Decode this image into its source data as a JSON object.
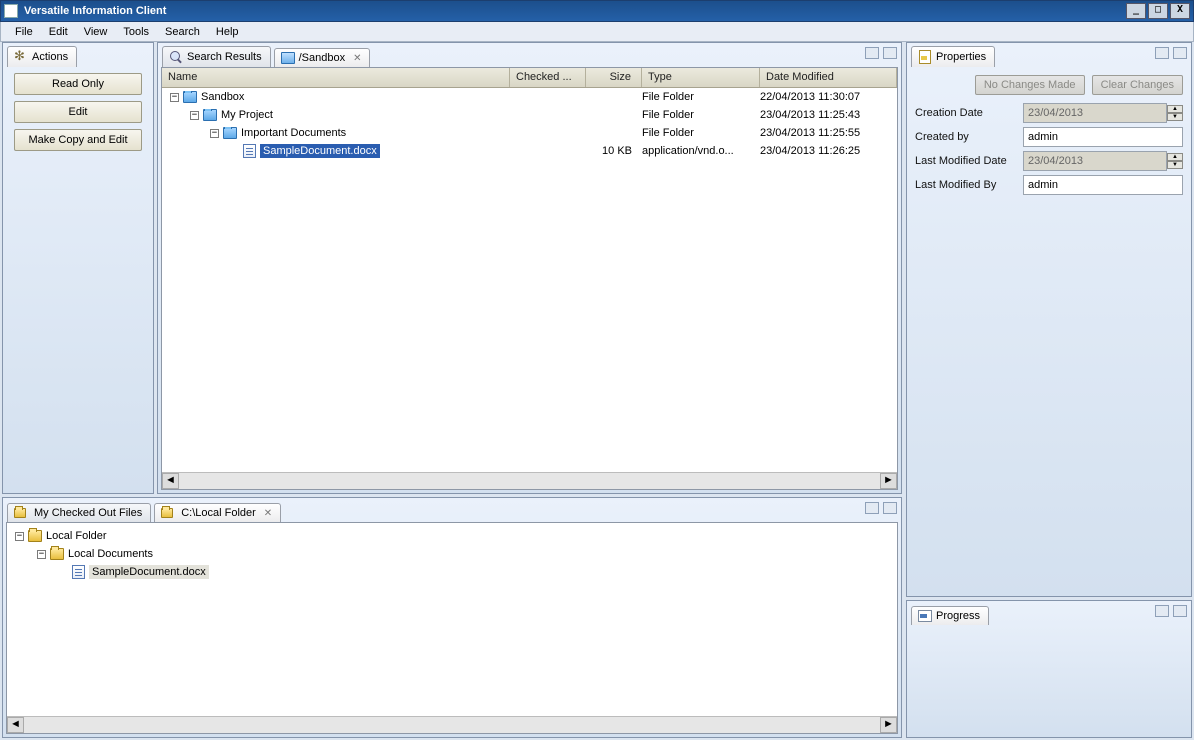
{
  "window": {
    "title": "Versatile Information Client"
  },
  "menubar": [
    "File",
    "Edit",
    "View",
    "Tools",
    "Search",
    "Help"
  ],
  "actions": {
    "tab_label": "Actions",
    "buttons": [
      "Read Only",
      "Edit",
      "Make Copy and Edit"
    ]
  },
  "mid": {
    "tabs": {
      "search": "Search Results",
      "sandbox": "/Sandbox"
    },
    "columns": {
      "name": "Name",
      "checked": "Checked ...",
      "size": "Size",
      "type": "Type",
      "date": "Date Modified"
    },
    "rows": [
      {
        "indent": 0,
        "twisty": "-",
        "icon": "folder-blue",
        "name": "Sandbox",
        "size": "",
        "type": "File Folder",
        "date": "22/04/2013 11:30:07",
        "selected": false
      },
      {
        "indent": 1,
        "twisty": "-",
        "icon": "folder-blue",
        "name": "My Project",
        "size": "",
        "type": "File Folder",
        "date": "23/04/2013 11:25:43",
        "selected": false
      },
      {
        "indent": 2,
        "twisty": "-",
        "icon": "folder-blue",
        "name": "Important Documents",
        "size": "",
        "type": "File Folder",
        "date": "23/04/2013 11:25:55",
        "selected": false
      },
      {
        "indent": 3,
        "twisty": "",
        "icon": "doc",
        "name": "SampleDocument.docx",
        "size": "10 KB",
        "type": "application/vnd.o...",
        "date": "23/04/2013 11:26:25",
        "selected": true
      }
    ]
  },
  "bottom": {
    "tabs": {
      "checked": "My Checked Out Files",
      "local": "C:\\Local Folder"
    },
    "tree": [
      {
        "indent": 0,
        "twisty": "-",
        "icon": "folder-yellow",
        "name": "Local Folder",
        "selected": false
      },
      {
        "indent": 1,
        "twisty": "-",
        "icon": "folder-yellow",
        "name": "Local Documents",
        "selected": false
      },
      {
        "indent": 2,
        "twisty": "",
        "icon": "doc",
        "name": "SampleDocument.docx",
        "selected": true
      }
    ]
  },
  "properties": {
    "tab_label": "Properties",
    "buttons": {
      "no_changes": "No Changes Made",
      "clear": "Clear Changes"
    },
    "fields": {
      "creation_date": {
        "label": "Creation Date",
        "value": "23/04/2013",
        "disabled": true,
        "spinner": true
      },
      "created_by": {
        "label": "Created by",
        "value": "admin",
        "disabled": false,
        "spinner": false
      },
      "last_modified_date": {
        "label": "Last Modified Date",
        "value": "23/04/2013",
        "disabled": true,
        "spinner": true
      },
      "last_modified_by": {
        "label": "Last Modified By",
        "value": "admin",
        "disabled": false,
        "spinner": false
      }
    }
  },
  "progress": {
    "tab_label": "Progress"
  }
}
